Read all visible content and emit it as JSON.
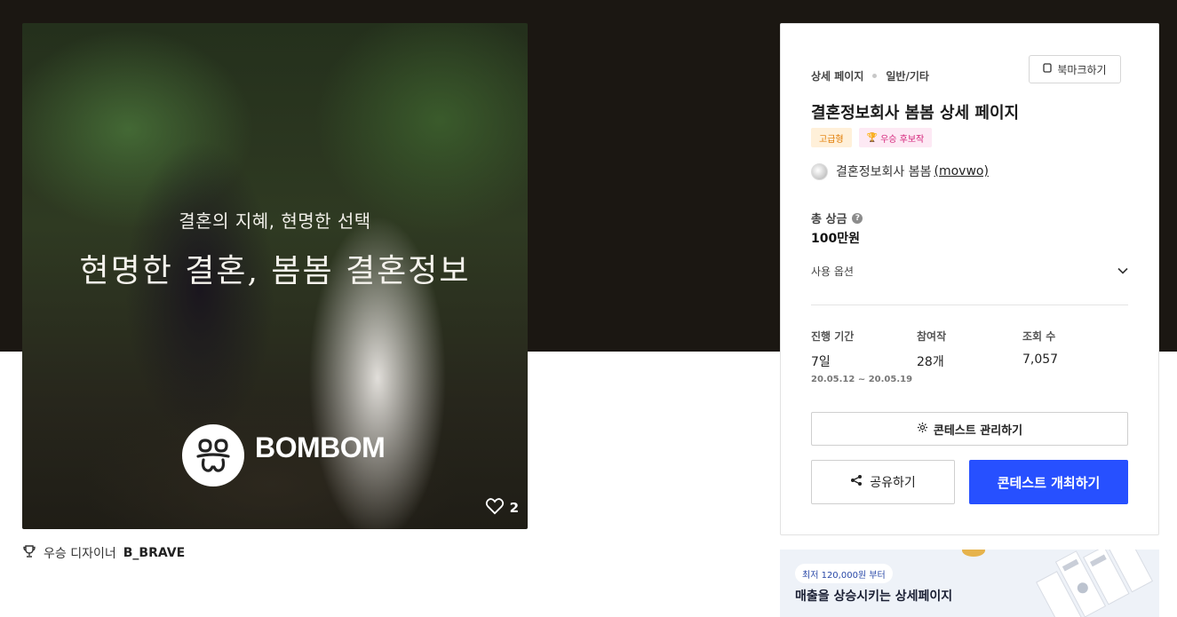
{
  "hero": {
    "subtitle": "결혼의 지혜, 현명한 선택",
    "title": "현명한 결혼, 봄봄 결혼정보",
    "brand": "BOMBOM",
    "likes": "2"
  },
  "winner": {
    "label": "우승 디자이너",
    "name": "B_BRAVE"
  },
  "panel": {
    "breadcrumb": [
      "상세 페이지",
      "일반/기타"
    ],
    "bookmark_label": "북마크하기",
    "title": "결혼정보회사 봄봄 상세 페이지",
    "badges": {
      "premium": "고급형",
      "award": "우승 후보작"
    },
    "owner": {
      "name": "결혼정보회사  봄봄",
      "handle": "(movwo)"
    },
    "prize_label": "총 상금",
    "prize_value": "100만원",
    "options_label": "사용 옵션",
    "stats": {
      "period_label": "진행 기간",
      "period_value": "7일",
      "period_range": "20.05.12 ~ 20.05.19",
      "entries_label": "참여작",
      "entries_value": "28개",
      "views_label": "조회 수",
      "views_value": "7,057"
    },
    "manage_label": "콘테스트 관리하기",
    "share_label": "공유하기",
    "host_label": "콘테스트 개최하기"
  },
  "ad": {
    "pill": "최저 120,000원 부터",
    "title": "매출을 상승시키는 상세페이지"
  },
  "colors": {
    "primary": "#2750ff",
    "dark_band": "#1b1712",
    "premium_badge_bg": "#fff0d9",
    "award_badge_bg": "#fde9f4"
  },
  "icons": [
    "heart-icon",
    "trophy-icon",
    "bookmark-icon",
    "help-icon",
    "chevron-down-icon",
    "gear-icon",
    "share-icon"
  ]
}
